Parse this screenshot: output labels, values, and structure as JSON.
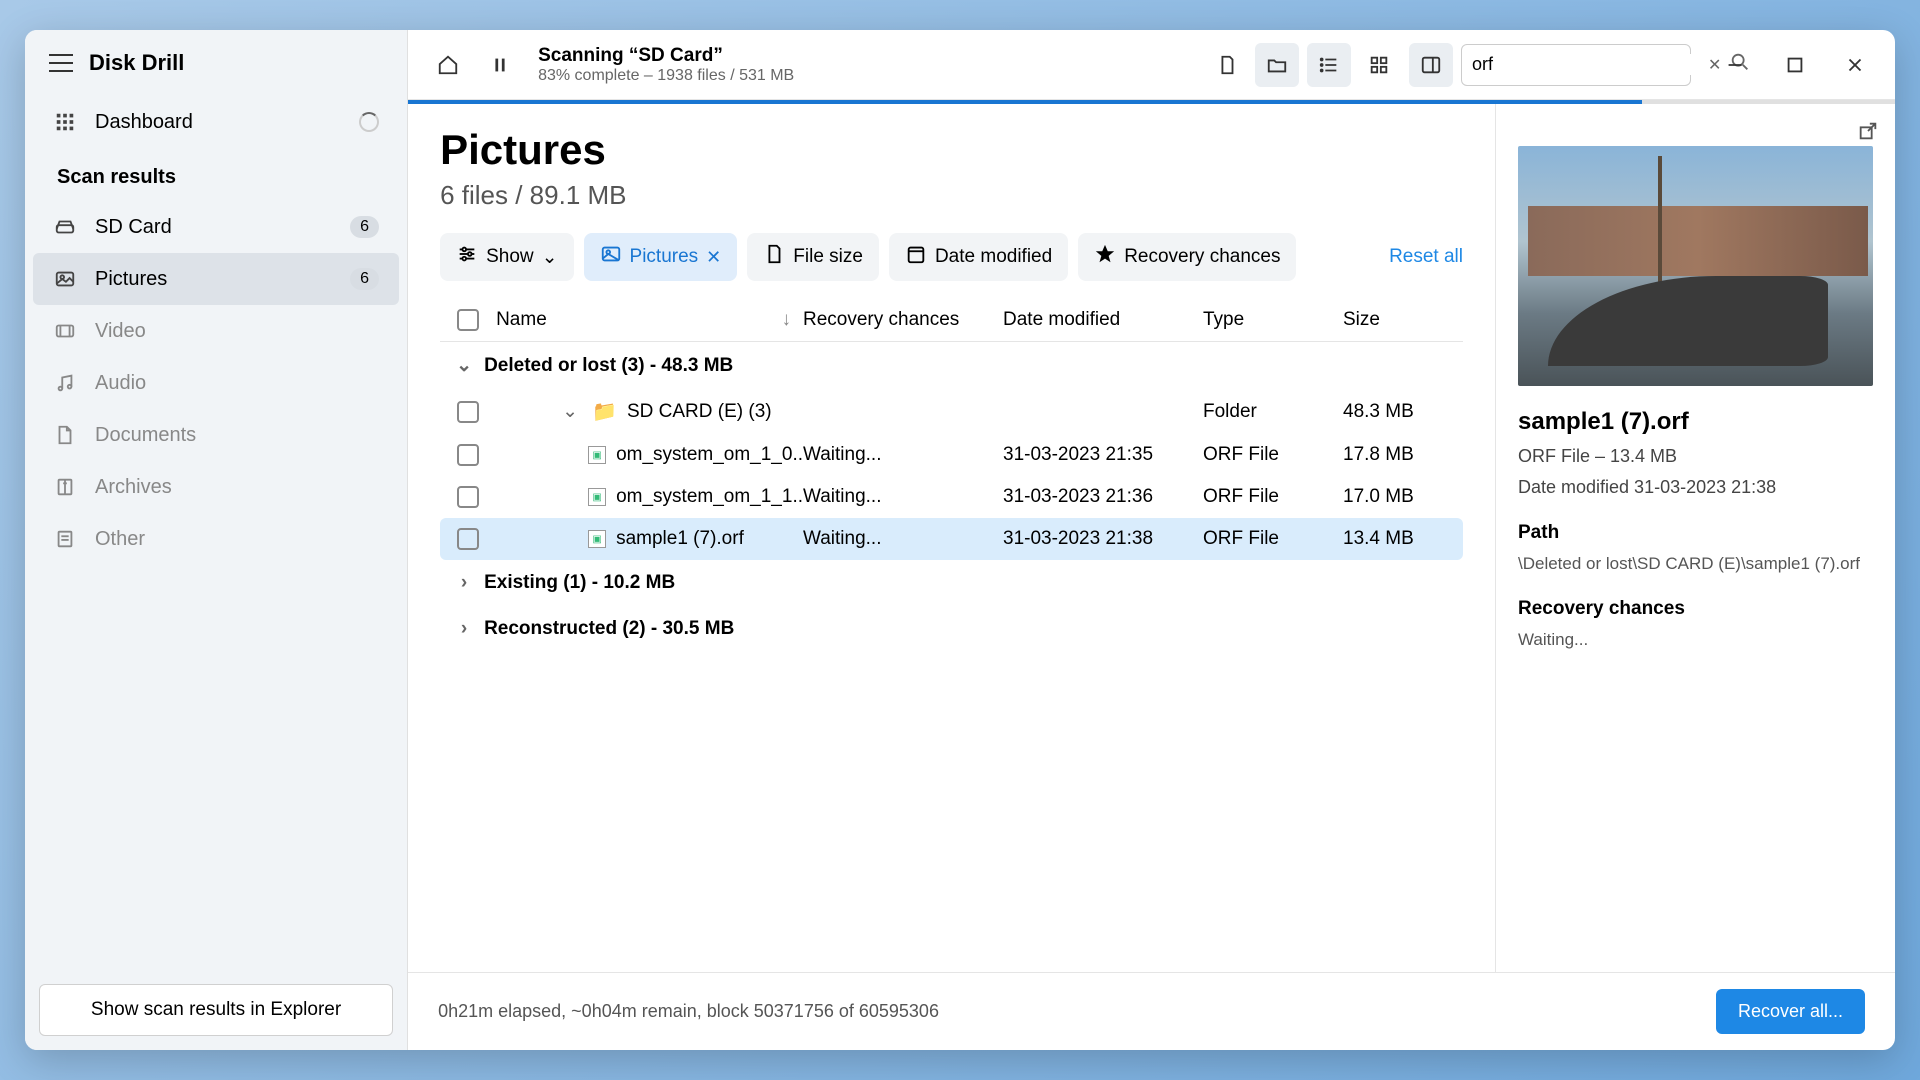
{
  "app": {
    "title": "Disk Drill"
  },
  "sidebar": {
    "dashboard": "Dashboard",
    "scan_results_label": "Scan results",
    "items": [
      {
        "label": "SD Card",
        "badge": "6"
      },
      {
        "label": "Pictures",
        "badge": "6"
      },
      {
        "label": "Video"
      },
      {
        "label": "Audio"
      },
      {
        "label": "Documents"
      },
      {
        "label": "Archives"
      },
      {
        "label": "Other"
      }
    ],
    "explorer_btn": "Show scan results in Explorer"
  },
  "topbar": {
    "scan_title": "Scanning “SD Card”",
    "scan_subtitle": "83% complete – 1938 files / 531 MB",
    "search_value": "orf"
  },
  "page": {
    "title": "Pictures",
    "subtitle": "6 files / 89.1 MB"
  },
  "filters": {
    "show": "Show",
    "pictures": "Pictures",
    "file_size": "File size",
    "date_modified": "Date modified",
    "recovery_chances": "Recovery chances",
    "reset_all": "Reset all"
  },
  "columns": {
    "name": "Name",
    "recovery": "Recovery chances",
    "date": "Date modified",
    "type": "Type",
    "size": "Size"
  },
  "groups": {
    "deleted": "Deleted or lost (3) - 48.3 MB",
    "existing": "Existing (1) - 10.2 MB",
    "reconstructed": "Reconstructed (2) - 30.5 MB"
  },
  "folder": {
    "name": "SD CARD (E) (3)",
    "type": "Folder",
    "size": "48.3 MB"
  },
  "files": [
    {
      "name": "om_system_om_1_0..",
      "recovery": "Waiting...",
      "date": "31-03-2023 21:35",
      "type": "ORF File",
      "size": "17.8 MB"
    },
    {
      "name": "om_system_om_1_1..",
      "recovery": "Waiting...",
      "date": "31-03-2023 21:36",
      "type": "ORF File",
      "size": "17.0 MB"
    },
    {
      "name": "sample1 (7).orf",
      "recovery": "Waiting...",
      "date": "31-03-2023 21:38",
      "type": "ORF File",
      "size": "13.4 MB"
    }
  ],
  "preview": {
    "name": "sample1 (7).orf",
    "meta1": "ORF File – 13.4 MB",
    "meta2": "Date modified 31-03-2023 21:38",
    "path_label": "Path",
    "path_value": "\\Deleted or lost\\SD CARD (E)\\sample1 (7).orf",
    "recovery_label": "Recovery chances",
    "recovery_value": "Waiting..."
  },
  "bottom": {
    "status": "0h21m elapsed, ~0h04m remain, block 50371756 of 60595306",
    "recover_btn": "Recover all..."
  }
}
